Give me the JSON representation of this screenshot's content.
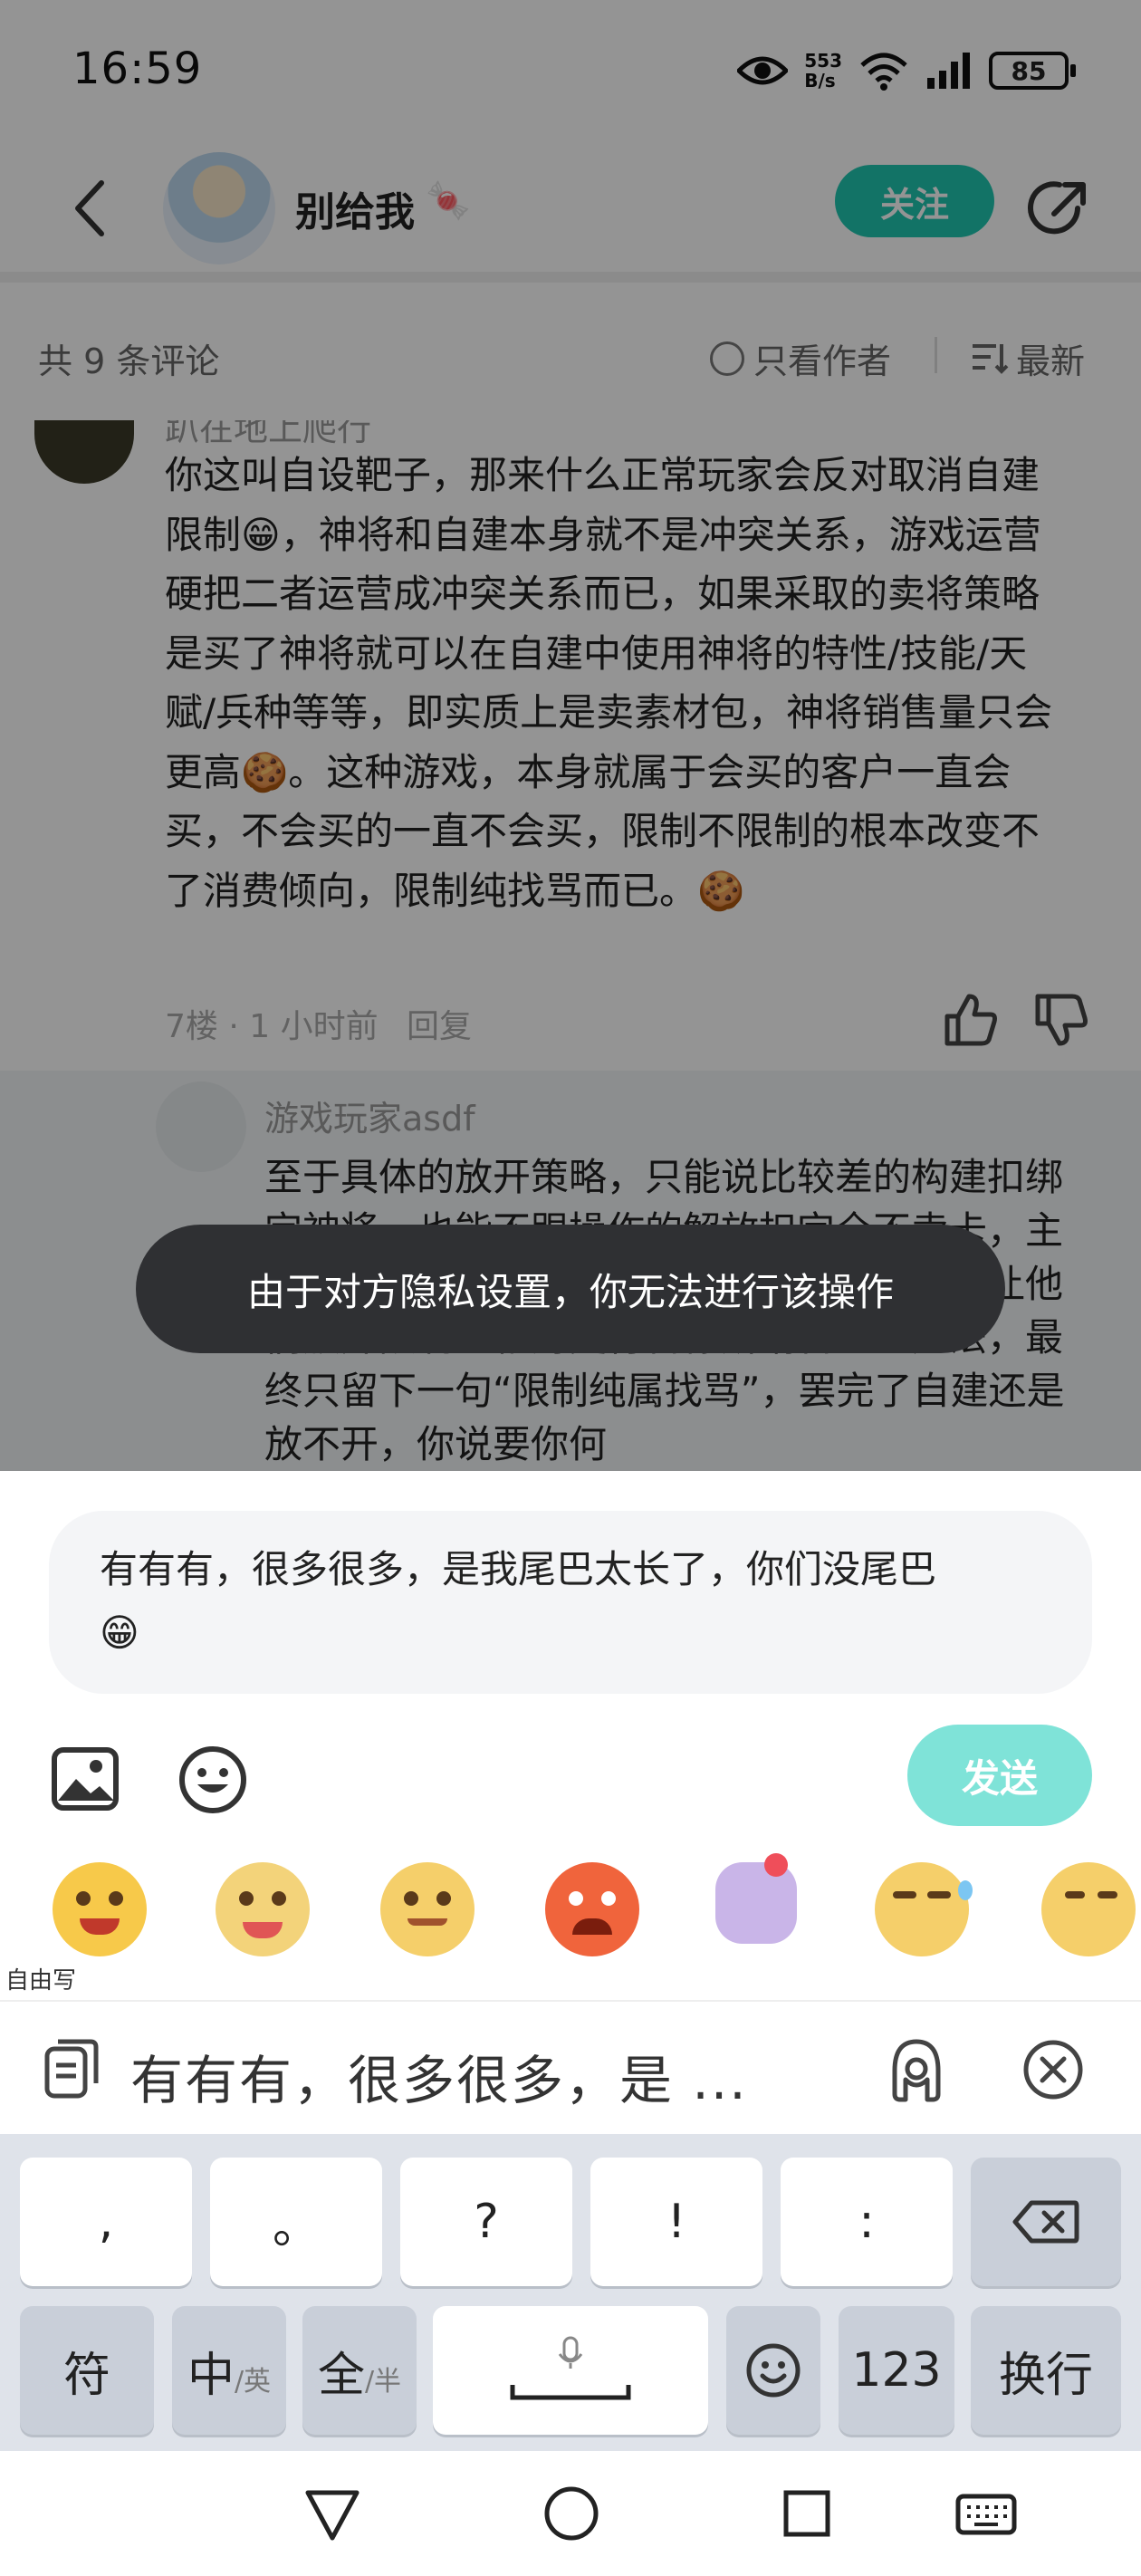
{
  "status_bar": {
    "time": "16:59",
    "net_speed_value": "553",
    "net_speed_unit": "B/s",
    "battery": "85"
  },
  "header": {
    "user_name": "别给我",
    "user_name_emoji": "🍬",
    "follow_label": "关注"
  },
  "filter_bar": {
    "comment_count": "共 9 条评论",
    "author_only_label": "只看作者",
    "sort_label": "最新"
  },
  "comments": {
    "c7": {
      "name": "趴在地上爬行",
      "body": "你这叫自设靶子，那来什么正常玩家会反对取消自建限制😁，神将和自建本身就不是冲突关系，游戏运营硬把二者运营成冲突关系而已，如果采取的卖将策略是买了神将就可以在自建中使用神将的特性/技能/天赋/兵种等等，即实质上是卖素材包，神将销售量只会更高🍪。这种游戏，本身就属于会买的客户一直会买，不会买的一直不会买，限制不限制的根本改变不了消费倾向，限制纯找骂而已。🍪",
      "meta": "7楼 · 1 小时前",
      "reply_label": "回复"
    },
    "reply": {
      "name": "游戏玩家asdf",
      "body": "至于具体的放开策略，只能说比较差的构建扣绑定神将，也能不跟操作的解放扣完全不卖卡，主要是为了卖神将卡，让用户都买不出一定能让他们放弃限制且相对更符合你所谓合理的办法，最终只留下一句“限制纯属找骂”，罢完了自建还是放不开，你说要你何"
    }
  },
  "toast": {
    "text": "由于对方隐私设置，你无法进行该操作"
  },
  "composer": {
    "input_text": "有有有，很多很多，是我尾巴太长了，你们没尾巴",
    "input_emoji": "😁",
    "send_label": "发送",
    "free_write_label": "自由写"
  },
  "ime": {
    "suggestion": "有有有，很多很多，是 ..."
  },
  "keyboard": {
    "row1": [
      ",",
      "。",
      "?",
      "!",
      ":"
    ],
    "symbols": "符",
    "lang_main": "中",
    "lang_alt": "/英",
    "width_main": "全",
    "width_alt": "/半",
    "numbers": "123",
    "enter": "换行"
  },
  "colors": {
    "accent": "#1fc6b0",
    "send_disabled": "#7fe3d8",
    "toast_bg": "#2f3033",
    "keyboard_bg": "#dfe3ea"
  }
}
